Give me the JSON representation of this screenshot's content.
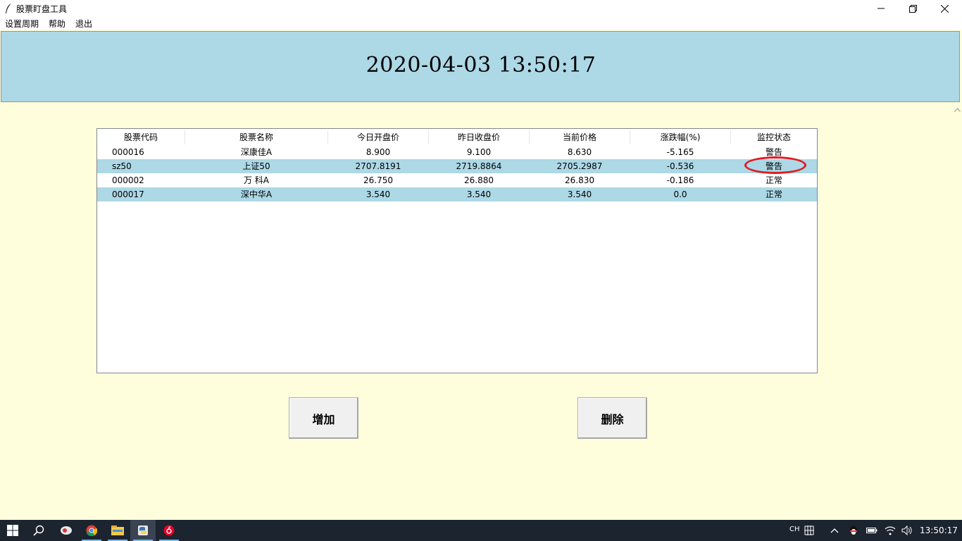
{
  "window": {
    "title": "股票盯盘工具",
    "controls": [
      "minimize",
      "maximize",
      "close"
    ]
  },
  "menu": {
    "items": [
      "设置周期",
      "帮助",
      "退出"
    ]
  },
  "clock": {
    "datetime": "2020-04-03 13:50:17"
  },
  "table": {
    "columns": [
      "股票代码",
      "股票名称",
      "今日开盘价",
      "昨日收盘价",
      "当前价格",
      "涨跌幅(%)",
      "监控状态"
    ],
    "rows": [
      {
        "code": "000016",
        "name": "深康佳A",
        "open": "8.900",
        "prev_close": "9.100",
        "current": "8.630",
        "change": "-5.165",
        "status": "警告"
      },
      {
        "code": "sz50",
        "name": "上证50",
        "open": "2707.8191",
        "prev_close": "2719.8864",
        "current": "2705.2987",
        "change": "-0.536",
        "status": "警告"
      },
      {
        "code": "000002",
        "name": "万 科A",
        "open": "26.750",
        "prev_close": "26.880",
        "current": "26.830",
        "change": "-0.186",
        "status": "正常"
      },
      {
        "code": "000017",
        "name": "深中华A",
        "open": "3.540",
        "prev_close": "3.540",
        "current": "3.540",
        "change": "0.0",
        "status": "正常"
      }
    ]
  },
  "buttons": {
    "add": "增加",
    "delete": "删除"
  },
  "colors": {
    "clock_bg": "#add8e6",
    "main_bg": "#fefedd",
    "alt_row": "#add8e6",
    "highlight_circle": "#e01b24",
    "taskbar_bg": "#1c2430"
  },
  "taskbar": {
    "apps": [
      "windows-start-icon",
      "search-icon",
      "app-icon",
      "chrome-icon",
      "file-explorer-icon",
      "python-icon",
      "netease-music-icon"
    ],
    "lang": "CH",
    "time": "13:50:17"
  }
}
